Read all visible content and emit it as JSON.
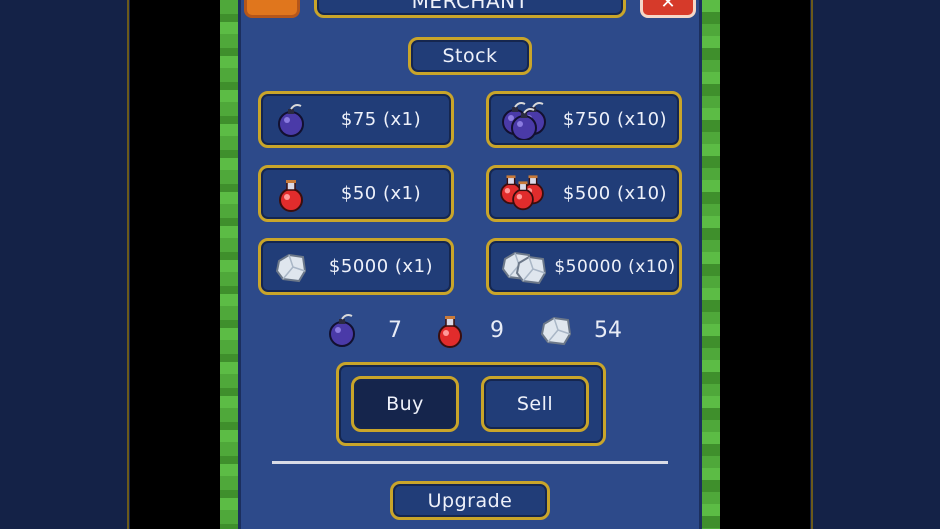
{
  "header": {
    "title": "MERCHANT"
  },
  "stock_label": "Stock",
  "items": [
    {
      "icon": "bomb-icon",
      "price": "$75 (x1)"
    },
    {
      "icon": "bomb-bundle-icon",
      "price": "$750 (x10)"
    },
    {
      "icon": "potion-icon",
      "price": "$50 (x1)"
    },
    {
      "icon": "potion-bundle-icon",
      "price": "$500 (x10)"
    },
    {
      "icon": "crystal-icon",
      "price": "$5000 (x1)"
    },
    {
      "icon": "crystal-bundle-icon",
      "price": "$50000 (x10)"
    }
  ],
  "inventory": {
    "bombs": "7",
    "potions": "9",
    "crystals": "54"
  },
  "mode": {
    "buy_label": "Buy",
    "sell_label": "Sell",
    "selected": "Buy"
  },
  "upgrade_label": "Upgrade",
  "colors": {
    "panel": "#2d4a8a",
    "gold_border": "#c9a52a",
    "button": "#213d78"
  }
}
